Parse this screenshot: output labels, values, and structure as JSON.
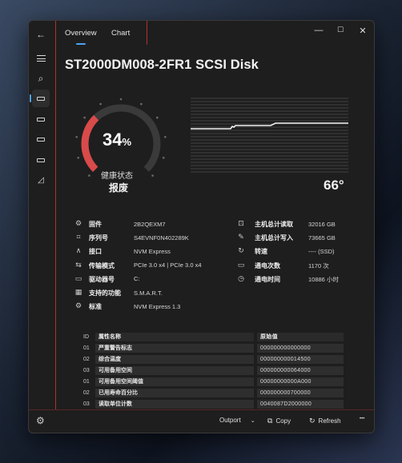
{
  "window": {
    "tabs": [
      "Overview",
      "Chart"
    ],
    "controls": [
      "—",
      "☐",
      "✕"
    ]
  },
  "disk": {
    "title": "ST2000DM008-2FR1 SCSI Disk",
    "health_percent": "34",
    "health_percent_suffix": "%",
    "health_value": 0.34,
    "health_label": "健康状态",
    "health_status": "报废",
    "temperature": "66°",
    "colors": {
      "gauge_fill": "#d94a4a",
      "gauge_track": "#3a3a3a",
      "accent": "#4ea3f2"
    }
  },
  "info_left": [
    {
      "icon": "chip-icon",
      "glyph": "⚙",
      "label": "固件",
      "value": "2B2QEXM7"
    },
    {
      "icon": "serial-icon",
      "glyph": "⌗",
      "label": "序列号",
      "value": "S4EVNF0N402289K"
    },
    {
      "icon": "interface-icon",
      "glyph": "∧",
      "label": "接口",
      "value": "NVM Express"
    },
    {
      "icon": "transfer-icon",
      "glyph": "⇆",
      "label": "传输模式",
      "value": "PCIe 3.0 x4 | PCIe 3.0 x4"
    },
    {
      "icon": "drive-letter-icon",
      "glyph": "▭",
      "label": "驱动器号",
      "value": "C:"
    },
    {
      "icon": "features-icon",
      "glyph": "▦",
      "label": "支持的功能",
      "value": "S.M.A.R.T."
    },
    {
      "icon": "standard-icon",
      "glyph": "⚙",
      "label": "标准",
      "value": "NVM Express 1.3"
    }
  ],
  "info_right": [
    {
      "icon": "host-read-icon",
      "glyph": "⊡",
      "label": "主机总计读取",
      "value": "32016 GB"
    },
    {
      "icon": "host-write-icon",
      "glyph": "✎",
      "label": "主机总计写入",
      "value": "73665 GB"
    },
    {
      "icon": "rotation-icon",
      "glyph": "↻",
      "label": "转速",
      "value": "---- (SSD)"
    },
    {
      "icon": "power-count-icon",
      "glyph": "▭",
      "label": "通电次数",
      "value": "1170 次"
    },
    {
      "icon": "power-time-icon",
      "glyph": "◷",
      "label": "通电时间",
      "value": "10886 小时"
    }
  ],
  "smart_table": {
    "headers": {
      "id": "ID",
      "name": "属性名称",
      "raw": "原始值"
    },
    "rows": [
      {
        "id": "01",
        "name": "严重警告标志",
        "raw": "000000000000000"
      },
      {
        "id": "02",
        "name": "综合温度",
        "raw": "000000000014500"
      },
      {
        "id": "03",
        "name": "可用备用空间",
        "raw": "000000000064000"
      },
      {
        "id": "01",
        "name": "可用备用空间阈值",
        "raw": "00000000000A000"
      },
      {
        "id": "02",
        "name": "已用寿命百分比",
        "raw": "000000000700000"
      },
      {
        "id": "03",
        "name": "读取单位计数",
        "raw": "0040087D2000000"
      }
    ]
  },
  "bottom_bar": {
    "outport": "Outport",
    "copy": "Copy",
    "refresh": "Refresh",
    "more": "•••"
  }
}
